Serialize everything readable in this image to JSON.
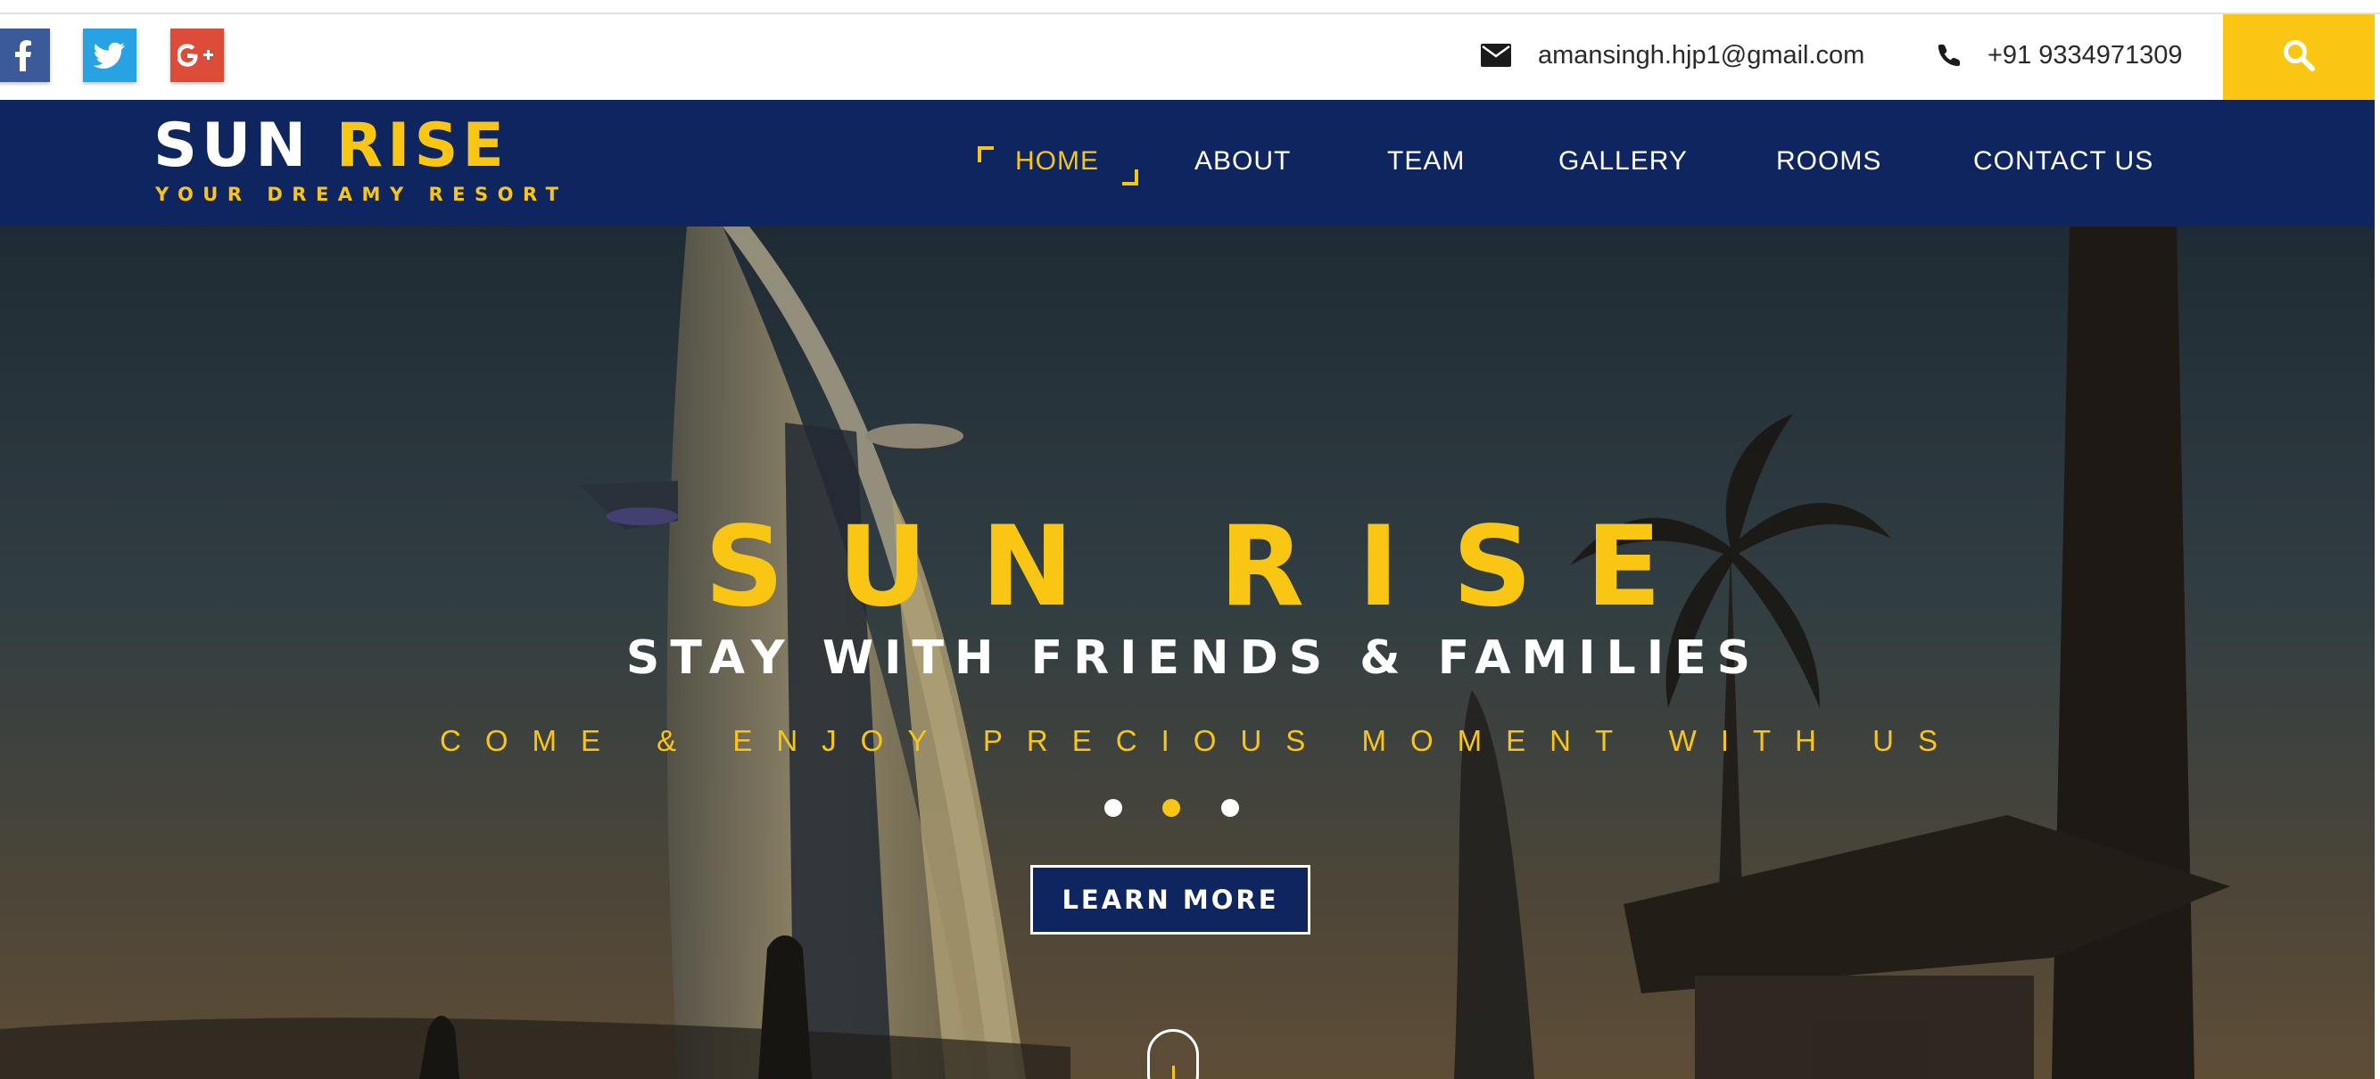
{
  "topbar": {
    "social": [
      {
        "name": "facebook",
        "icon": "facebook-icon",
        "color": "#3b5a9a"
      },
      {
        "name": "twitter",
        "icon": "twitter-icon",
        "color": "#27a3e4"
      },
      {
        "name": "google-plus",
        "icon": "google-plus-icon",
        "color": "#dd4b39"
      }
    ],
    "email": {
      "icon": "envelope-icon",
      "text": "amansingh.hjp1@gmail.com"
    },
    "phone": {
      "icon": "phone-icon",
      "text": "+91 9334971309"
    },
    "search": {
      "icon": "search-icon",
      "color": "#f8c613"
    }
  },
  "nav": {
    "logo_title_main": "SUN",
    "logo_title_accent": "RISE",
    "logo_subtitle": "YOUR DREAMY RESORT",
    "items": [
      "HOME",
      "ABOUT",
      "TEAM",
      "GALLERY",
      "ROOMS",
      "CONTACT US"
    ],
    "active_item": "HOME"
  },
  "hero": {
    "title": "SUN RISE",
    "subtitle": "STAY WITH FRIENDS & FAMILIES",
    "tagline": "COME & ENJOY PRECIOUS MOMENT WITH US",
    "slides_total": 3,
    "active_slide": 2,
    "cta_label": "LEARN MORE",
    "scroll_icon": "scroll-down-mouse-icon"
  },
  "colors": {
    "accent": "#f8c613",
    "navy": "#0f2560",
    "white": "#ffffff"
  }
}
